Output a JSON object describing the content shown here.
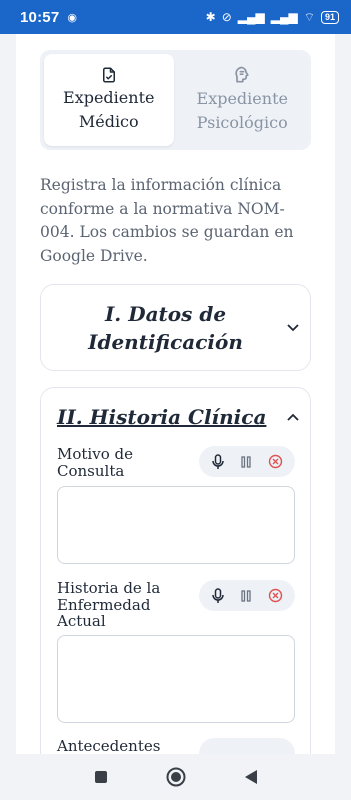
{
  "status_bar": {
    "time": "10:57",
    "battery": "91"
  },
  "tabs": [
    {
      "label": "Expediente Médico",
      "icon": "medical-file-icon",
      "active": true
    },
    {
      "label": "Expediente Psicológico",
      "icon": "head-brain-icon",
      "active": false
    }
  ],
  "intro_text": "Registra la información clínica conforme a la normativa NOM-004. Los cambios se guardan en Google Drive.",
  "sections": [
    {
      "title": "I. Datos de Identificación",
      "expanded": false
    },
    {
      "title": "II. Historia Clínica",
      "expanded": true
    }
  ],
  "fields": [
    {
      "label": "Motivo de Consulta"
    },
    {
      "label": "Historia de la Enfermedad Actual"
    },
    {
      "label": "Antecedentes"
    }
  ],
  "colors": {
    "accent": "#1a66c9",
    "stop_red": "#e05252"
  }
}
